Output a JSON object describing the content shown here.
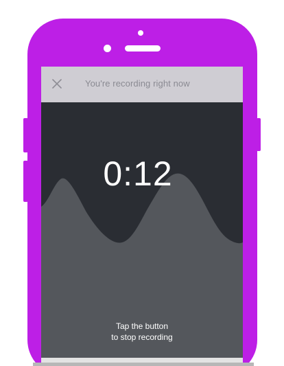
{
  "device": {
    "frame_color": "#bd1fe6"
  },
  "recording": {
    "title": "You're recording right now",
    "close_icon": "close-icon",
    "timer": "0:12",
    "hint_line1": "Tap the button",
    "hint_line2": "to stop recording"
  },
  "colors": {
    "topbar": "#cfcdd3",
    "dark_background": "#2a2d33",
    "wave": "#54575c",
    "text": "#ffffff"
  }
}
